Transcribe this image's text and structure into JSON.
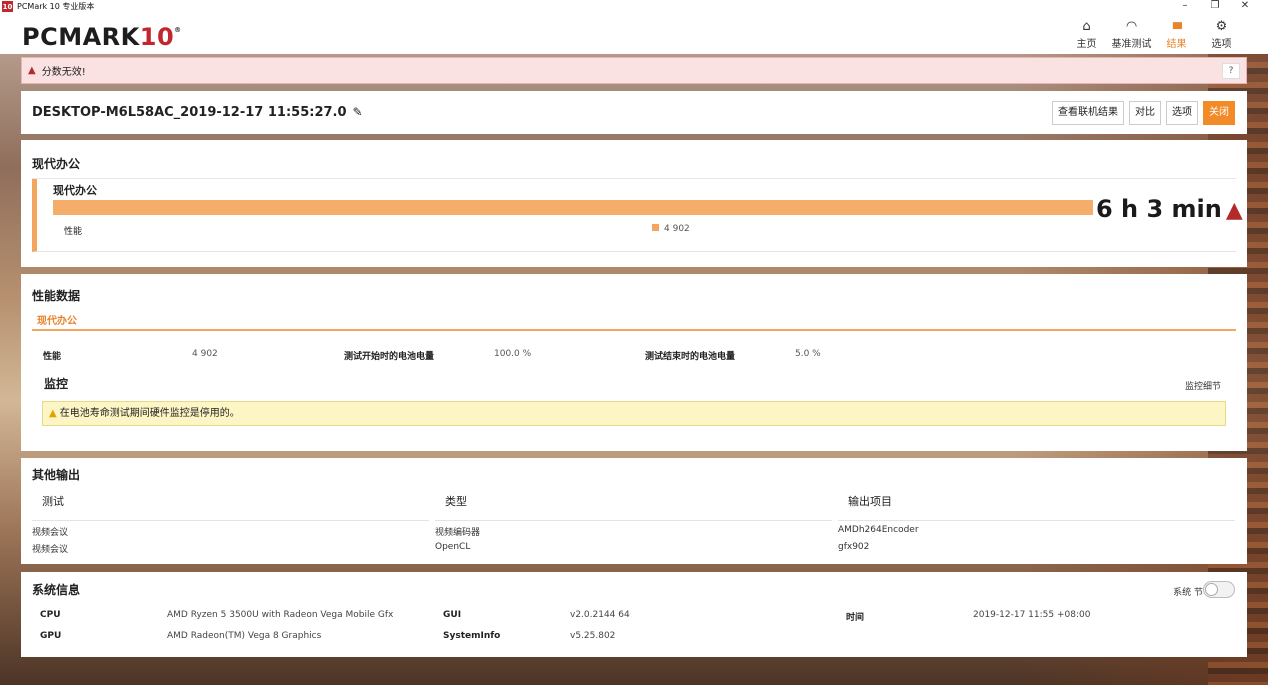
{
  "window": {
    "app_icon_text": "10",
    "title": "PCMark 10 专业版本",
    "controls": [
      "–",
      "❐",
      "✕"
    ]
  },
  "header": {
    "logo_main": "PCMARK",
    "logo_num": "10",
    "logo_mark": "®",
    "nav": [
      {
        "label": "主页",
        "icon": "home-icon",
        "glyph": "⌂"
      },
      {
        "label": "基准测试",
        "icon": "gauge-icon",
        "glyph": "◠"
      },
      {
        "label": "结果",
        "icon": "bar-chart-icon",
        "glyph": "▮▮▮",
        "active": true
      },
      {
        "label": "选项",
        "icon": "gear-icon",
        "glyph": "⚙"
      }
    ]
  },
  "alert": {
    "text": "分数无效!",
    "help": "?"
  },
  "result": {
    "title": "DESKTOP-M6L58AC_2019-12-17 11:55:27.0",
    "buttons": [
      "查看联机结果",
      "对比",
      "选项",
      "关闭"
    ]
  },
  "score": {
    "section_title": "现代办公",
    "subtitle": "现代办公",
    "big_value": "6 h 3 min",
    "metric_label": "性能",
    "metric_value": "4 902",
    "bar_fill_fraction": 1.0,
    "accent": "#f5ad6b"
  },
  "perf": {
    "section_title": "性能数据",
    "tab": "现代办公",
    "rows": {
      "perf_label": "性能",
      "perf_value": "4 902",
      "start_label": "测试开始时的电池电量",
      "start_value": "100.0 %",
      "end_label": "测试结束时的电池电量",
      "end_value": "5.0 %"
    },
    "monitor_title": "监控",
    "monitor_link": "监控细节",
    "monitor_warning": "在电池寿命测试期间硬件监控是停用的。"
  },
  "other": {
    "section_title": "其他输出",
    "columns": [
      "测试",
      "类型",
      "输出项目"
    ],
    "rows": [
      [
        "视频会议",
        "视频编码器",
        "AMDh264Encoder"
      ],
      [
        "视频会议",
        "OpenCL",
        "gfx902"
      ]
    ]
  },
  "system": {
    "section_title": "系统信息",
    "toggle_label": "系统 节",
    "items": {
      "cpu_label": "CPU",
      "cpu_value": "AMD Ryzen 5 3500U with Radeon Vega Mobile Gfx",
      "gui_label": "GUI",
      "gui_value": "v2.0.2144 64",
      "time_label": "时间",
      "time_value": "2019-12-17 11:55 +08:00",
      "gpu_label": "GPU",
      "gpu_value": "AMD Radeon(TM) Vega 8 Graphics",
      "si_label": "SystemInfo",
      "si_value": "v5.25.802"
    }
  }
}
